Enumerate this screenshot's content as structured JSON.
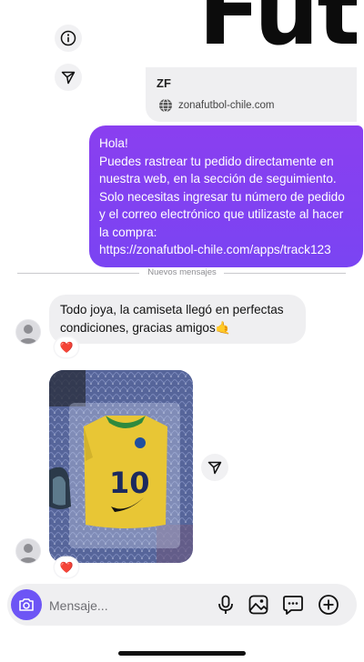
{
  "link_preview": {
    "brand_text": "Fut",
    "title": "ZF",
    "domain": "zonafutbol-chile.com",
    "icon": "globe-icon"
  },
  "side_actions": {
    "info_icon": "info-icon",
    "share_icon": "share-icon"
  },
  "outgoing_message": {
    "text": "Hola!\nPuedes rastrear tu pedido directamente en nuestra web, en la sección de seguimiento.\nSolo necesitas ingresar tu número de pedido y el correo electrónico que utilizaste al hacer la compra:\nhttps://zonafutbol-chile.com/apps/track123",
    "color": "#8a3ff0"
  },
  "divider": {
    "label": "Nuevos mensajes"
  },
  "incoming_message": {
    "text": "Todo joya, la camiseta llegó en perfectas condiciones, gracias amigos🤙",
    "reaction": "❤️"
  },
  "incoming_photo": {
    "jersey_number": "10",
    "reaction": "❤️"
  },
  "composer": {
    "placeholder": "Mensaje...",
    "accent": "#6d55f5",
    "icons": [
      "camera-icon",
      "microphone-icon",
      "gallery-icon",
      "sticker-icon",
      "add-icon"
    ]
  }
}
